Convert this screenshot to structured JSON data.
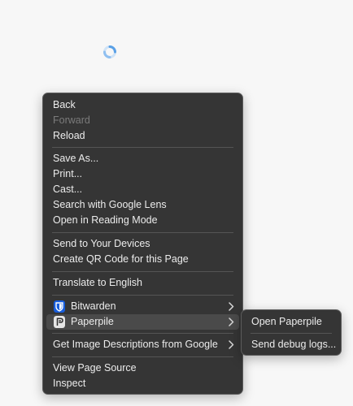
{
  "context_menu": {
    "items": [
      {
        "label": "Back"
      },
      {
        "label": "Forward"
      },
      {
        "label": "Reload"
      },
      {
        "label": "Save As..."
      },
      {
        "label": "Print..."
      },
      {
        "label": "Cast..."
      },
      {
        "label": "Search with Google Lens"
      },
      {
        "label": "Open in Reading Mode"
      },
      {
        "label": "Send to Your Devices"
      },
      {
        "label": "Create QR Code for this Page"
      },
      {
        "label": "Translate to English"
      },
      {
        "label": "Bitwarden",
        "icon": "bitwarden-icon"
      },
      {
        "label": "Paperpile",
        "icon": "paperpile-icon"
      },
      {
        "label": "Get Image Descriptions from Google"
      },
      {
        "label": "View Page Source"
      },
      {
        "label": "Inspect"
      }
    ]
  },
  "submenu": {
    "items": [
      {
        "label": "Open Paperpile"
      },
      {
        "label": "Send debug logs..."
      }
    ]
  },
  "colors": {
    "page_background": "#f7f7f7",
    "menu_background": "#353535",
    "menu_text": "#ececec",
    "disabled_text": "#7b7b7b",
    "highlight": "#4a4a4a",
    "bitwarden_blue": "#175ddc",
    "spinner_blue": "#5aa0e6"
  }
}
